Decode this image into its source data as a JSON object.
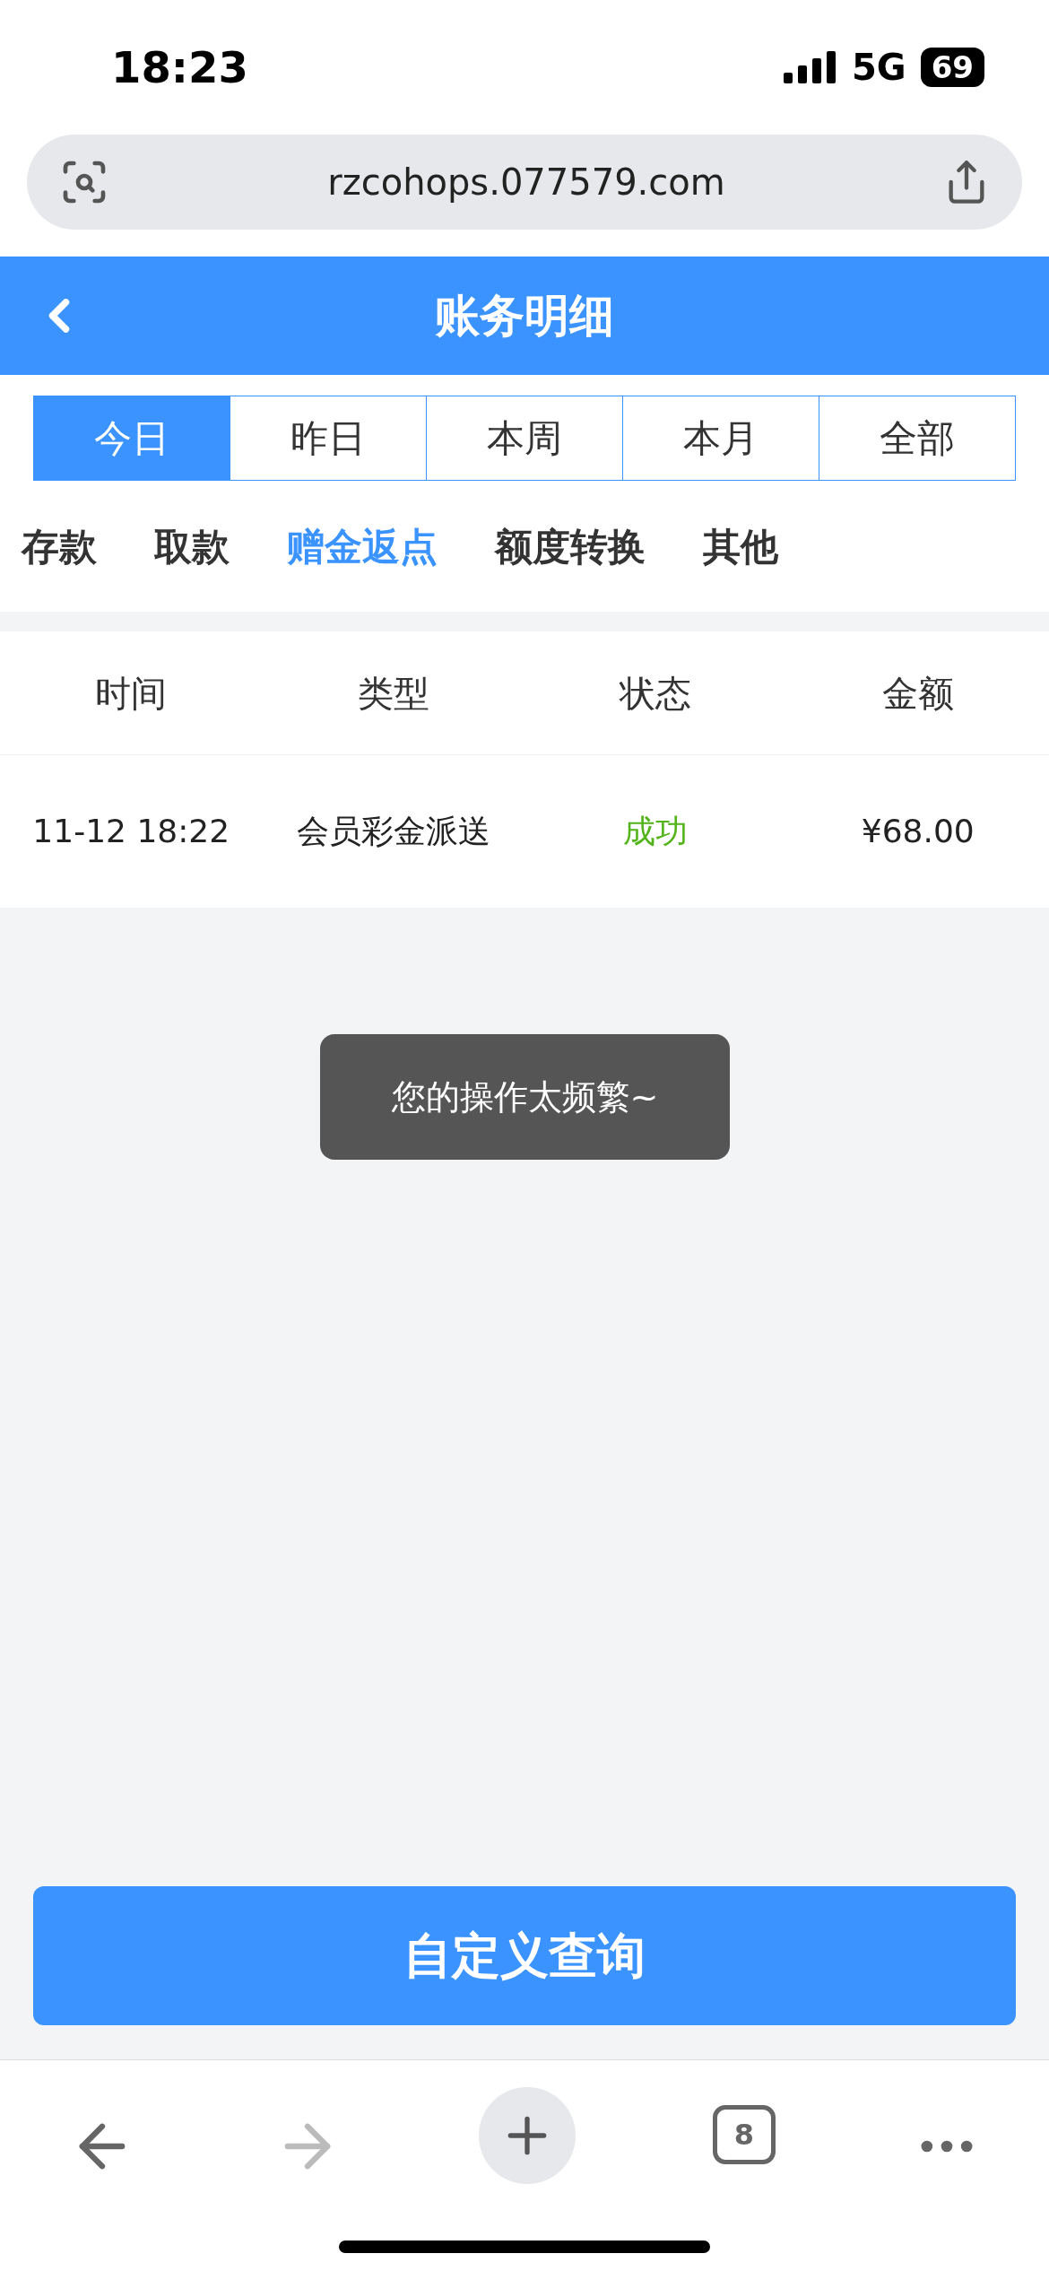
{
  "status_bar": {
    "time": "18:23",
    "network": "5G",
    "battery": "69"
  },
  "browser": {
    "url": "rzcohops.077579.com",
    "tab_count": "8"
  },
  "header": {
    "title": "账务明细"
  },
  "period_tabs": [
    {
      "label": "今日",
      "selected": true
    },
    {
      "label": "昨日",
      "selected": false
    },
    {
      "label": "本周",
      "selected": false
    },
    {
      "label": "本月",
      "selected": false
    },
    {
      "label": "全部",
      "selected": false
    }
  ],
  "category_tabs": [
    {
      "label": "存款",
      "selected": false
    },
    {
      "label": "取款",
      "selected": false
    },
    {
      "label": "赠金返点",
      "selected": true
    },
    {
      "label": "额度转换",
      "selected": false
    },
    {
      "label": "其他",
      "selected": false
    }
  ],
  "table": {
    "columns": [
      "时间",
      "类型",
      "状态",
      "金额"
    ],
    "rows": [
      {
        "time": "11-12 18:22",
        "type": "会员彩金派送",
        "status": "成功",
        "amount": "¥68.00"
      }
    ]
  },
  "toast": "您的操作太频繁~",
  "query_button": "自定义查询"
}
